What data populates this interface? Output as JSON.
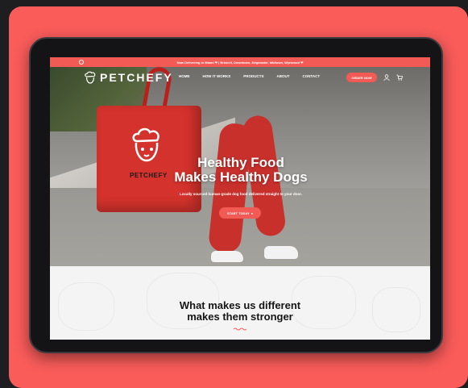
{
  "announcement": "Now Delivering in Miami ❤ | Brickell, Downtown, Edgewater, Midtown, Wynwood ❤",
  "brand": {
    "name": "PETCHEFY",
    "logo": "chef-dog-icon"
  },
  "nav": {
    "links": [
      "HOME",
      "HOW IT WORKS",
      "PRODUCTS",
      "ABOUT",
      "CONTACT"
    ],
    "order_button": "ORDER NOW",
    "icons": [
      "user-icon",
      "cart-icon"
    ]
  },
  "hero": {
    "headline_line1": "Healthy Food",
    "headline_line2": "Makes Healthy Dogs",
    "subtext": "Locally sourced human-grade dog food delivered straight to your door.",
    "cta": "START TODAY",
    "bag_text": "PETCHEFY"
  },
  "section": {
    "title_line1": "What makes us different",
    "title_line2": "makes them stronger"
  },
  "colors": {
    "accent": "#f25b55",
    "card": "#fa5c5a",
    "background": "#1e1e20",
    "bag": "#d4322c"
  }
}
